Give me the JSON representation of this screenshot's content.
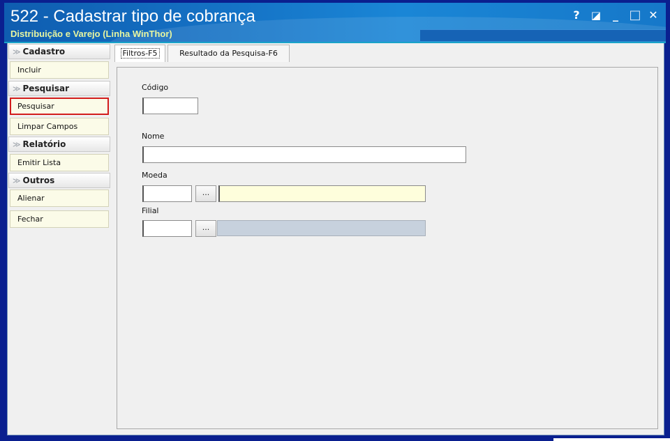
{
  "window": {
    "title": "522 - Cadastrar tipo de cobrança",
    "subtitle": "Distribuição e Varejo (Linha WinThor)",
    "controls": {
      "help": "?",
      "restore": "◪",
      "minimize": "_",
      "maximize": "□",
      "close": "✕"
    }
  },
  "sidebar": {
    "groups": [
      {
        "label": "Cadastro",
        "items": [
          "Incluir"
        ]
      },
      {
        "label": "Pesquisar",
        "items": [
          "Pesquisar",
          "Limpar Campos"
        ]
      },
      {
        "label": "Relatório",
        "items": [
          "Emitir Lista"
        ]
      },
      {
        "label": "Outros",
        "items": [
          "Alienar",
          "Fechar"
        ]
      }
    ],
    "chevron": "≫"
  },
  "tabs": [
    {
      "label": "Filtros-F5",
      "active": true
    },
    {
      "label": "Resultado da Pesquisa-F6",
      "active": false
    }
  ],
  "form": {
    "codigo_label": "Código",
    "codigo_value": "",
    "nome_label": "Nome",
    "nome_value": "",
    "moeda_label": "Moeda",
    "moeda_value": "",
    "filial_label": "Filial",
    "filial_value": "",
    "lookup_button": "..."
  },
  "colors": {
    "title_gradient_start": "#0f5db0",
    "subtitle_text": "#e8f6a0",
    "frame": "#0a1f8f",
    "selected_outline": "#d21c1c",
    "sidebar_button_bg": "#fbfbe8",
    "moeda_desc_bg": "#fefedc",
    "filial_desc_bg": "#c7d1dd"
  }
}
